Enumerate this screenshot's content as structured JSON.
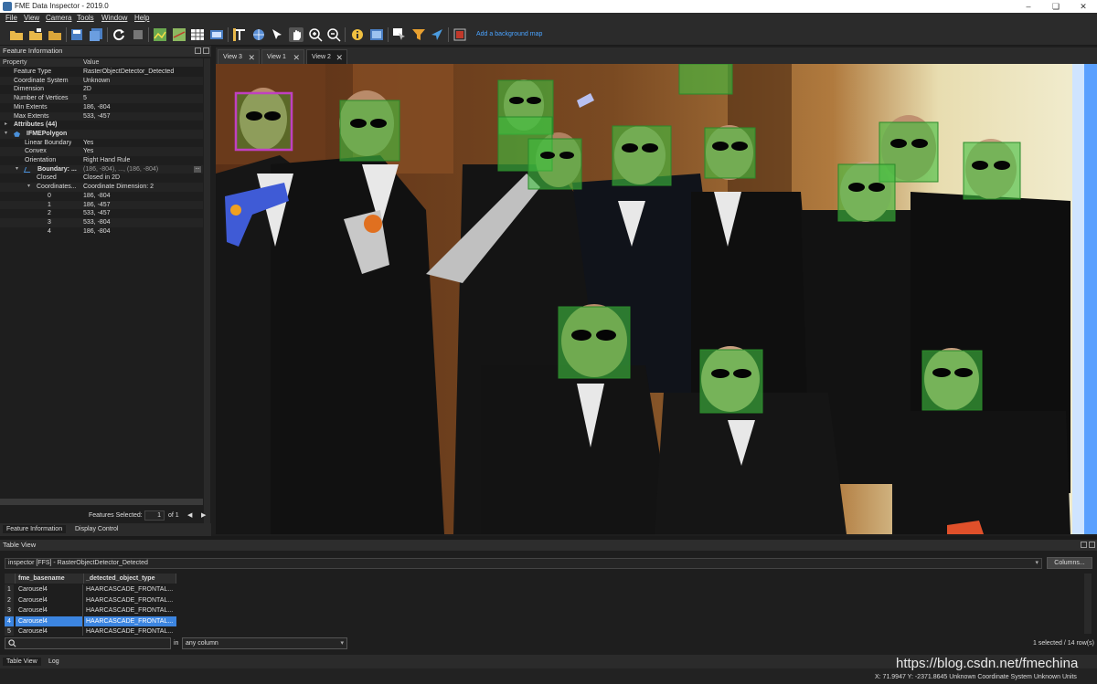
{
  "window": {
    "title": "FME Data Inspector - 2019.0"
  },
  "menu": [
    "File",
    "View",
    "Camera",
    "Tools",
    "Window",
    "Help"
  ],
  "toolbar": {
    "background_map_link": "Add a background map"
  },
  "feature_panel": {
    "title": "Feature Information",
    "col_property": "Property",
    "col_value": "Value",
    "rows": [
      {
        "k": "Feature Type",
        "v": "RasterObjectDetector_Detected"
      },
      {
        "k": "Coordinate System",
        "v": "Unknown"
      },
      {
        "k": "Dimension",
        "v": "2D"
      },
      {
        "k": "Number of Vertices",
        "v": "5"
      },
      {
        "k": "Min Extents",
        "v": "186, -804"
      },
      {
        "k": "Max Extents",
        "v": "533, -457"
      },
      {
        "k": "Attributes (44)",
        "v": ""
      },
      {
        "k": "IFMEPolygon",
        "v": ""
      },
      {
        "k": "Linear Boundary",
        "v": "Yes"
      },
      {
        "k": "Convex",
        "v": "Yes"
      },
      {
        "k": "Orientation",
        "v": "Right Hand Rule"
      },
      {
        "k": "Boundary: ...",
        "v": "(186, -804), ..., (186, -804)"
      },
      {
        "k": "Closed",
        "v": "Closed in 2D"
      },
      {
        "k": "Coordinates...",
        "v": "Coordinate Dimension: 2"
      },
      {
        "k": "0",
        "v": "186, -804"
      },
      {
        "k": "1",
        "v": "186, -457"
      },
      {
        "k": "2",
        "v": "533, -457"
      },
      {
        "k": "3",
        "v": "533, -804"
      },
      {
        "k": "4",
        "v": "186, -804"
      }
    ],
    "features_selected_label": "Features Selected:",
    "features_selected_value": "1",
    "features_of": "of 1",
    "tabs": [
      "Feature Information",
      "Display Control"
    ]
  },
  "view_tabs": [
    "View 3",
    "View 1",
    "View 2"
  ],
  "table_view": {
    "title": "Table View",
    "source": "inspector [FFS] - RasterObjectDetector_Detected",
    "columns_button": "Columns...",
    "headers": [
      "fme_basename",
      "_detected_object_type"
    ],
    "rows": [
      {
        "n": "1",
        "a": "Carousel4",
        "b": "HAARCASCADE_FRONTAL..."
      },
      {
        "n": "2",
        "a": "Carousel4",
        "b": "HAARCASCADE_FRONTAL..."
      },
      {
        "n": "3",
        "a": "Carousel4",
        "b": "HAARCASCADE_FRONTAL..."
      },
      {
        "n": "4",
        "a": "Carousel4",
        "b": "HAARCASCADE_FRONTAL..."
      },
      {
        "n": "5",
        "a": "Carousel4",
        "b": "HAARCASCADE_FRONTAL..."
      }
    ],
    "selected_row_index": 3,
    "in_label": "in",
    "filter_column": "any column",
    "selected_count": "1 selected / 14 row(s)",
    "tabs": [
      "Table View",
      "Log"
    ]
  },
  "status": {
    "coords": "X:   71.9947   Y:   -2371.8645   Unknown Coordinate System   Unknown Units"
  },
  "watermark": "https://blog.csdn.net/fmechina",
  "colors": {
    "accent": "#3c85e0",
    "detection_fill": "#3fbf3f",
    "selected_outline": "#c040c0"
  }
}
